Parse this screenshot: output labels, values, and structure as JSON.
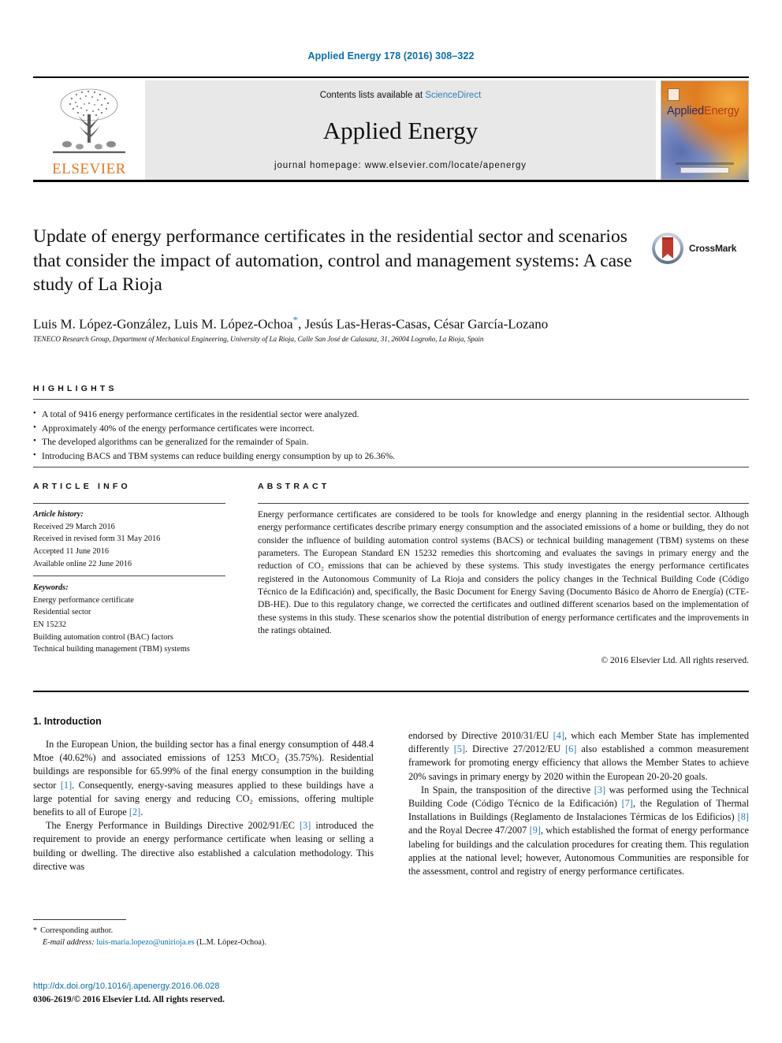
{
  "running_head": "Applied Energy 178 (2016) 308–322",
  "masthead": {
    "publisher_name": "ELSEVIER",
    "contents_prefix": "Contents lists available at ",
    "contents_link": "ScienceDirect",
    "journal_name": "Applied Energy",
    "homepage": "journal homepage: www.elsevier.com/locate/apenergy",
    "cover_title_a": "Applied",
    "cover_title_b": "Energy"
  },
  "article": {
    "title": "Update of energy performance certificates in the residential sector and scenarios that consider the impact of automation, control and management systems: A case study of La Rioja",
    "crossmark_label": "CrossMark",
    "authors": "Luis M. López-González, Luis M. López-Ochoa",
    "authors_rest": ", Jesús Las-Heras-Casas, César García-Lozano",
    "corresponding_mark": "*",
    "affiliation": "TENECO Research Group, Department of Mechanical Engineering, University of La Rioja, Calle San José de Calasanz, 31, 26004 Logroño, La Rioja, Spain"
  },
  "highlights": {
    "heading": "HIGHLIGHTS",
    "items": [
      "A total of 9416 energy performance certificates in the residential sector were analyzed.",
      "Approximately 40% of the energy performance certificates were incorrect.",
      "The developed algorithms can be generalized for the remainder of Spain.",
      "Introducing BACS and TBM systems can reduce building energy consumption by up to 26.36%."
    ]
  },
  "article_info": {
    "heading": "ARTICLE INFO",
    "history_label": "Article history:",
    "history": [
      "Received 29 March 2016",
      "Received in revised form 31 May 2016",
      "Accepted 11 June 2016",
      "Available online 22 June 2016"
    ],
    "keywords_label": "Keywords:",
    "keywords": [
      "Energy performance certificate",
      "Residential sector",
      "EN 15232",
      "Building automation control (BAC) factors",
      "Technical building management (TBM) systems"
    ]
  },
  "abstract": {
    "heading": "ABSTRACT",
    "text": "Energy performance certificates are considered to be tools for knowledge and energy planning in the residential sector. Although energy performance certificates describe primary energy consumption and the associated emissions of a home or building, they do not consider the influence of building automation control systems (BACS) or technical building management (TBM) systems on these parameters. The European Standard EN 15232 remedies this shortcoming and evaluates the savings in primary energy and the reduction of CO₂ emissions that can be achieved by these systems. This study investigates the energy performance certificates registered in the Autonomous Community of La Rioja and considers the policy changes in the Technical Building Code (Código Técnico de la Edificación) and, specifically, the Basic Document for Energy Saving (Documento Básico de Ahorro de Energía) (CTE-DB-HE). Due to this regulatory change, we corrected the certificates and outlined different scenarios based on the implementation of these systems in this study. These scenarios show the potential distribution of energy performance certificates and the improvements in the ratings obtained.",
    "copyright": "© 2016 Elsevier Ltd. All rights reserved."
  },
  "body": {
    "section_title": "1. Introduction",
    "left_paragraphs": [
      "In the European Union, the building sector has a final energy consumption of 448.4 Mtoe (40.62%) and associated emissions of 1253 MtCO₂ (35.75%). Residential buildings are responsible for 65.99% of the final energy consumption in the building sector [1]. Consequently, energy-saving measures applied to these buildings have a large potential for saving energy and reducing CO₂ emissions, offering multiple benefits to all of Europe [2].",
      "The Energy Performance in Buildings Directive 2002/91/EC [3] introduced the requirement to provide an energy performance certificate when leasing or selling a building or dwelling. The directive also established a calculation methodology. This directive was"
    ],
    "right_paragraphs": [
      "endorsed by Directive 2010/31/EU [4], which each Member State has implemented differently [5]. Directive 27/2012/EU [6] also established a common measurement framework for promoting energy efficiency that allows the Member States to achieve 20% savings in primary energy by 2020 within the European 20-20-20 goals.",
      "In Spain, the transposition of the directive [3] was performed using the Technical Building Code (Código Técnico de la Edificación) [7], the Regulation of Thermal Installations in Buildings (Reglamento de Instalaciones Térmicas de los Edificios) [8] and the Royal Decree 47/2007 [9], which established the format of energy performance labeling for buildings and the calculation procedures for creating them. This regulation applies at the national level; however, Autonomous Communities are responsible for the assessment, control and registry of energy performance certificates."
    ]
  },
  "footer": {
    "corresponding_author": "Corresponding author.",
    "email_label": "E-mail address:",
    "email": "luis-maria.lopezo@unirioja.es",
    "email_owner": "(L.M. López-Ochoa).",
    "doi": "http://dx.doi.org/10.1016/j.apenergy.2016.06.028",
    "issn_line": "0306-2619/© 2016 Elsevier Ltd. All rights reserved."
  },
  "colors": {
    "link": "#0b6ea8",
    "accent": "#2f7fb5",
    "elsevier_orange": "#e87722"
  }
}
